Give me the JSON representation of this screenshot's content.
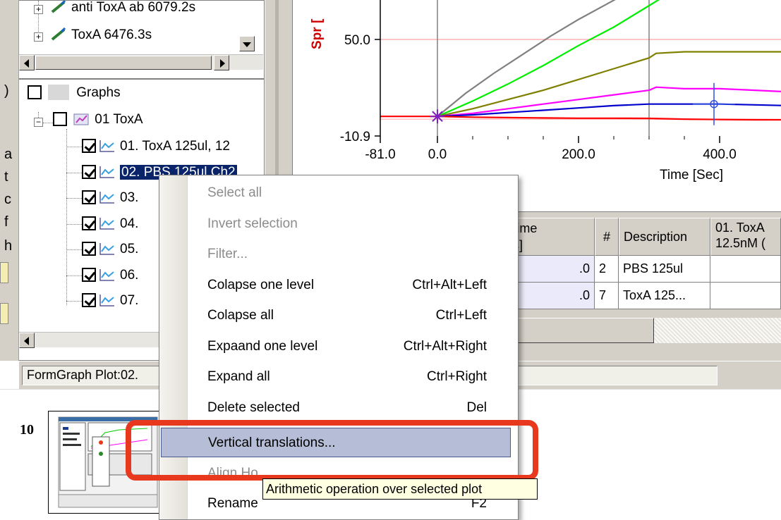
{
  "left_strip": {
    "hints": [
      ")",
      "a",
      "t",
      "c",
      "f",
      "h"
    ]
  },
  "tree_top": {
    "items": [
      {
        "label": "anti ToxA ab 6079.2s"
      },
      {
        "label": "ToxA 6476.3s"
      }
    ]
  },
  "tree": {
    "root_label": "Graphs",
    "group_label": "01 ToxA",
    "plots": [
      {
        "label": "01. ToxA 125ul, 12",
        "checked": true,
        "selected": false
      },
      {
        "label": "02. PBS 125ul Ch2",
        "checked": true,
        "selected": true
      },
      {
        "label": "03.",
        "checked": true,
        "selected": false
      },
      {
        "label": "04.",
        "checked": true,
        "selected": false
      },
      {
        "label": "05.",
        "checked": true,
        "selected": false
      },
      {
        "label": "06.",
        "checked": true,
        "selected": false
      },
      {
        "label": "07.",
        "checked": true,
        "selected": false
      }
    ]
  },
  "chart_data": {
    "type": "line",
    "ylabel": "Spr [",
    "xlabel": "Time [Sec]",
    "x_ticks": [
      "-81.0",
      "0.0",
      "200.0",
      "400.0"
    ],
    "y_ticks": [
      "50.0",
      "-10.9"
    ],
    "xlim": [
      -81,
      540
    ],
    "ylim": [
      -10.9,
      85
    ],
    "reference_lines_y": [
      50.0
    ],
    "vertical_markers_x": [
      0,
      300
    ],
    "series": [
      {
        "color": "#808080",
        "points": [
          [
            0,
            0
          ],
          [
            40,
            15
          ],
          [
            80,
            28
          ],
          [
            120,
            40
          ],
          [
            160,
            52
          ],
          [
            200,
            63
          ],
          [
            240,
            73
          ],
          [
            280,
            83
          ]
        ]
      },
      {
        "color": "#00ee00",
        "points": [
          [
            0,
            0
          ],
          [
            50,
            10
          ],
          [
            100,
            21
          ],
          [
            150,
            33
          ],
          [
            200,
            46
          ],
          [
            250,
            58
          ],
          [
            300,
            72
          ],
          [
            350,
            86
          ]
        ]
      },
      {
        "color": "#808000",
        "points": [
          [
            0,
            0
          ],
          [
            50,
            5
          ],
          [
            100,
            11
          ],
          [
            150,
            17
          ],
          [
            200,
            24
          ],
          [
            250,
            31
          ],
          [
            300,
            38
          ],
          [
            310,
            41
          ],
          [
            350,
            42
          ],
          [
            400,
            42
          ],
          [
            450,
            42
          ],
          [
            540,
            42
          ]
        ]
      },
      {
        "color": "#ff00ff",
        "points": [
          [
            0,
            0
          ],
          [
            50,
            2
          ],
          [
            100,
            5
          ],
          [
            150,
            8
          ],
          [
            200,
            11
          ],
          [
            250,
            14
          ],
          [
            300,
            17
          ],
          [
            310,
            19
          ],
          [
            350,
            18
          ],
          [
            400,
            18
          ],
          [
            450,
            17
          ],
          [
            540,
            15
          ]
        ]
      },
      {
        "color": "#0000cc",
        "points": [
          [
            0,
            0
          ],
          [
            50,
            1
          ],
          [
            100,
            2.5
          ],
          [
            150,
            4
          ],
          [
            200,
            5.5
          ],
          [
            250,
            7
          ],
          [
            300,
            8
          ],
          [
            350,
            8
          ],
          [
            400,
            8
          ],
          [
            450,
            7.5
          ],
          [
            540,
            6.5
          ]
        ]
      },
      {
        "color": "#ff0000",
        "points": [
          [
            -81,
            0
          ],
          [
            0,
            0
          ],
          [
            50,
            -0.5
          ],
          [
            100,
            -0.8
          ],
          [
            150,
            -1
          ],
          [
            200,
            -1.2
          ],
          [
            250,
            -1.2
          ],
          [
            300,
            -1.3
          ],
          [
            350,
            -1.8
          ],
          [
            400,
            -2
          ],
          [
            450,
            -2.2
          ],
          [
            540,
            -2.3
          ]
        ]
      }
    ],
    "cursor": {
      "x": 392,
      "y": 8
    },
    "origin_marker": {
      "x": 0,
      "y": 0
    }
  },
  "grid": {
    "headers": {
      "time_l1": "Time",
      "time_l2": "[s]",
      "num": "#",
      "description": "Description",
      "plot1_l1": "01. ToxA",
      "plot1_l2": "12.5nM ("
    },
    "rows": [
      {
        "time": ".0",
        "num": "2",
        "description": "PBS 125ul"
      },
      {
        "time": ".0",
        "num": "7",
        "description": "ToxA 125..."
      }
    ]
  },
  "status": {
    "text": "FormGraph Plot:02."
  },
  "thumbnail": {
    "slide_number": "10"
  },
  "menu": {
    "items": [
      {
        "label": "Select all",
        "shortcut": "",
        "disabled": true
      },
      {
        "label": "Invert selection",
        "shortcut": "",
        "disabled": true
      },
      {
        "label": "Filter...",
        "shortcut": "",
        "disabled": true
      },
      {
        "label": "Colapse one level",
        "shortcut": "Ctrl+Alt+Left",
        "disabled": false
      },
      {
        "label": "Colapse all",
        "shortcut": "Ctrl+Left",
        "disabled": false
      },
      {
        "label": "Expaand one level",
        "shortcut": "Ctrl+Alt+Right",
        "disabled": false
      },
      {
        "label": "Expand all",
        "shortcut": "Ctrl+Right",
        "disabled": false
      },
      {
        "label": "Delete selected",
        "shortcut": "Del",
        "disabled": false
      },
      {
        "label": "Vertical translations...",
        "shortcut": "",
        "disabled": false,
        "hover": true
      },
      {
        "label": "Align Ho",
        "shortcut": "",
        "disabled": true
      },
      {
        "label": "Rename",
        "shortcut": "F2",
        "disabled": false
      }
    ]
  },
  "tooltip": {
    "text": "Arithmetic operation over selected plot"
  },
  "colors": {
    "selection": "#0a246a",
    "menu_hover": "#b5bed6",
    "highlight_ring": "#e8391e",
    "tooltip_bg": "#ffffe1"
  }
}
